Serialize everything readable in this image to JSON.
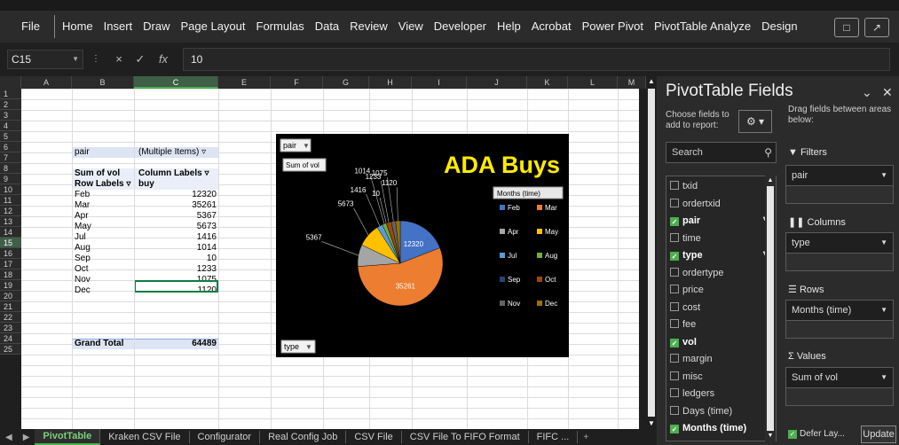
{
  "ribbon": {
    "tabs": [
      "File",
      "Home",
      "Insert",
      "Draw",
      "Page Layout",
      "Formulas",
      "Data",
      "Review",
      "View",
      "Developer",
      "Help",
      "Acrobat",
      "Power Pivot",
      "PivotTable Analyze",
      "Design"
    ],
    "comment_icon": "comment-icon",
    "share_icon": "share-icon"
  },
  "formula_bar": {
    "name_box": "C15",
    "value": "10",
    "cancel_symbol": "×",
    "enter_symbol": "✓",
    "fx_symbol": "fx"
  },
  "grid": {
    "columns": [
      "A",
      "B",
      "C",
      "E",
      "F",
      "G",
      "H",
      "I",
      "J",
      "K",
      "L",
      "M"
    ],
    "selected_column": "C",
    "rows": [
      "1",
      "2",
      "3",
      "4",
      "5",
      "6",
      "7",
      "8",
      "9",
      "10",
      "11",
      "12",
      "13",
      "14",
      "15",
      "16",
      "17",
      "18",
      "19",
      "20",
      "21",
      "22",
      "23",
      "24",
      "25"
    ],
    "selected_row": "15"
  },
  "pivot": {
    "filter_label": "pair",
    "filter_value": "(Multiple Items)",
    "values_label": "Sum of vol",
    "column_labels": "Column Labels",
    "row_labels": "Row Labels",
    "column_item": "buy",
    "rows": [
      {
        "label": "Feb",
        "value": "12320"
      },
      {
        "label": "Mar",
        "value": "35261"
      },
      {
        "label": "Apr",
        "value": "5367"
      },
      {
        "label": "May",
        "value": "5673"
      },
      {
        "label": "Jul",
        "value": "1416"
      },
      {
        "label": "Aug",
        "value": "1014"
      },
      {
        "label": "Sep",
        "value": "10"
      },
      {
        "label": "Oct",
        "value": "1233"
      },
      {
        "label": "Nov",
        "value": "1075"
      },
      {
        "label": "Dec",
        "value": "1120"
      }
    ],
    "grand_total_label": "Grand Total",
    "grand_total_value": "64489"
  },
  "chart_data": {
    "type": "pie",
    "title": "ADA Buys",
    "filter_button": "pair",
    "value_button": "Sum of vol",
    "axis_button": "type",
    "legend_title": "Months (time)",
    "categories": [
      "Feb",
      "Mar",
      "Apr",
      "May",
      "Jul",
      "Aug",
      "Sep",
      "Oct",
      "Nov",
      "Dec"
    ],
    "values": [
      12320,
      35261,
      5367,
      5673,
      1416,
      1014,
      10,
      1233,
      1075,
      1120
    ],
    "colors": [
      "#4472c4",
      "#ed7d31",
      "#a5a5a5",
      "#ffc000",
      "#5b9bd5",
      "#70ad47",
      "#264478",
      "#9e480e",
      "#636363",
      "#997300"
    ],
    "data_labels": [
      "12320",
      "35261",
      "5367",
      "5673",
      "1416",
      "1014",
      "10",
      "1233",
      "1075",
      "1120"
    ],
    "legend_position": "right"
  },
  "sheet_tabs": {
    "tabs": [
      "PivotTable",
      "Kraken CSV File",
      "Configurator",
      "Real Config Job",
      "CSV File",
      "CSV File To FIFO Format",
      "FIFC ..."
    ],
    "active": "PivotTable",
    "add_icon": "+"
  },
  "pivot_pane": {
    "title": "PivotTable Fields",
    "choose_label": "Choose fields to add to report:",
    "drag_label": "Drag fields between areas below:",
    "search_placeholder": "Search",
    "fields": [
      {
        "name": "txid",
        "checked": false
      },
      {
        "name": "ordertxid",
        "checked": false
      },
      {
        "name": "pair",
        "checked": true,
        "filtered": true
      },
      {
        "name": "time",
        "checked": false
      },
      {
        "name": "type",
        "checked": true,
        "filtered": true
      },
      {
        "name": "ordertype",
        "checked": false
      },
      {
        "name": "price",
        "checked": false
      },
      {
        "name": "cost",
        "checked": false
      },
      {
        "name": "fee",
        "checked": false
      },
      {
        "name": "vol",
        "checked": true
      },
      {
        "name": "margin",
        "checked": false
      },
      {
        "name": "misc",
        "checked": false
      },
      {
        "name": "ledgers",
        "checked": false
      },
      {
        "name": "Days (time)",
        "checked": false
      },
      {
        "name": "Months (time)",
        "checked": true
      }
    ],
    "areas": {
      "filters": {
        "label": "Filters",
        "item": "pair"
      },
      "columns": {
        "label": "Columns",
        "item": "type"
      },
      "rows": {
        "label": "Rows",
        "item": "Months (time)"
      },
      "values": {
        "label": "Values",
        "item": "Sum of vol"
      }
    },
    "defer_label": "Defer Lay...",
    "update_label": "Update"
  }
}
